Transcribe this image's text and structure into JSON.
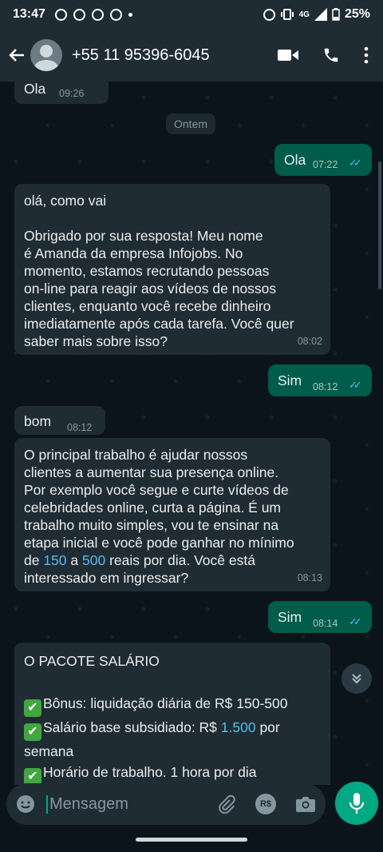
{
  "statusbar": {
    "time": "13:47",
    "network": "4G",
    "battery": "25%"
  },
  "header": {
    "contact": "+55 11 95396-6045"
  },
  "chat": {
    "date_chip": "Ontem",
    "messages": [
      {
        "dir": "in",
        "text": "Ola",
        "time": "09:26"
      },
      {
        "dir": "out",
        "text": "Ola",
        "time": "07:22"
      },
      {
        "dir": "in",
        "text": "olá, como vai\n\nObrigado por sua resposta! Meu nome\né Amanda da empresa Infojobs. No\nmomento, estamos recrutando pessoas\non-line para reagir aos vídeos de nossos\nclientes, enquanto você recebe dinheiro\nimediatamente após cada tarefa. Você quer\nsaber mais sobre isso?",
        "time": "08:02"
      },
      {
        "dir": "out",
        "text": "Sim",
        "time": "08:12"
      },
      {
        "dir": "in",
        "text": "bom",
        "time": "08:12"
      },
      {
        "dir": "in",
        "text_a": "O principal trabalho é ajudar nossos\nclientes a aumentar sua presença online.\nPor exemplo você segue e curte vídeos de\ncelebridades online, curta a página. É um\ntrabalho muito simples, vou te ensinar na\netapa inicial e você pode ganhar no mínimo\nde ",
        "num1": "150",
        "text_b": " a ",
        "num2": "500",
        "text_c": " reais por dia. Você está\ninteressado em ingressar?",
        "time": "08:13"
      },
      {
        "dir": "out",
        "text": "Sim",
        "time": "08:14"
      },
      {
        "dir": "in",
        "title": "O PACOTE SALÁRIO",
        "line1": "Bônus: liquidação diária de R$ 150-500",
        "line2_a": "Salário base subsidiado: R$ ",
        "line2_num": "1.500",
        "line2_b": " por\nsemana",
        "line3": "Horário de trabalho. 1 hora por dia"
      }
    ]
  },
  "input": {
    "placeholder": "Mensagem",
    "currency_icon_label": "R$"
  },
  "colors": {
    "incoming": "#202c33",
    "outgoing": "#005c4b",
    "accent": "#00a884",
    "read_tick": "#53bdeb"
  }
}
